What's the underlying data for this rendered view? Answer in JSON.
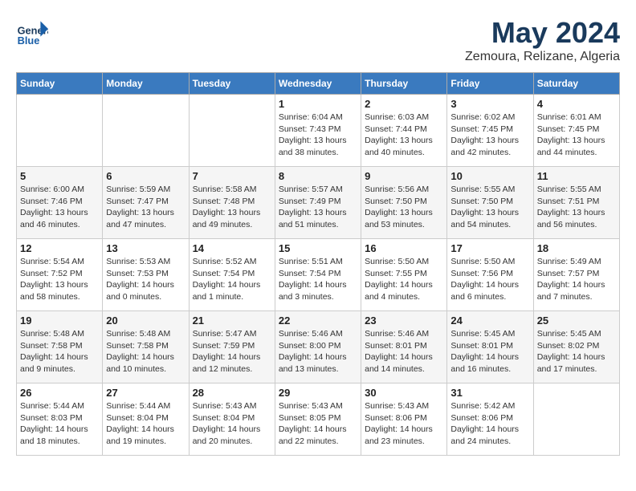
{
  "header": {
    "logo_line1": "General",
    "logo_line2": "Blue",
    "month": "May 2024",
    "location": "Zemoura, Relizane, Algeria"
  },
  "days_of_week": [
    "Sunday",
    "Monday",
    "Tuesday",
    "Wednesday",
    "Thursday",
    "Friday",
    "Saturday"
  ],
  "weeks": [
    [
      {
        "day": "",
        "info": ""
      },
      {
        "day": "",
        "info": ""
      },
      {
        "day": "",
        "info": ""
      },
      {
        "day": "1",
        "info": "Sunrise: 6:04 AM\nSunset: 7:43 PM\nDaylight: 13 hours\nand 38 minutes."
      },
      {
        "day": "2",
        "info": "Sunrise: 6:03 AM\nSunset: 7:44 PM\nDaylight: 13 hours\nand 40 minutes."
      },
      {
        "day": "3",
        "info": "Sunrise: 6:02 AM\nSunset: 7:45 PM\nDaylight: 13 hours\nand 42 minutes."
      },
      {
        "day": "4",
        "info": "Sunrise: 6:01 AM\nSunset: 7:45 PM\nDaylight: 13 hours\nand 44 minutes."
      }
    ],
    [
      {
        "day": "5",
        "info": "Sunrise: 6:00 AM\nSunset: 7:46 PM\nDaylight: 13 hours\nand 46 minutes."
      },
      {
        "day": "6",
        "info": "Sunrise: 5:59 AM\nSunset: 7:47 PM\nDaylight: 13 hours\nand 47 minutes."
      },
      {
        "day": "7",
        "info": "Sunrise: 5:58 AM\nSunset: 7:48 PM\nDaylight: 13 hours\nand 49 minutes."
      },
      {
        "day": "8",
        "info": "Sunrise: 5:57 AM\nSunset: 7:49 PM\nDaylight: 13 hours\nand 51 minutes."
      },
      {
        "day": "9",
        "info": "Sunrise: 5:56 AM\nSunset: 7:50 PM\nDaylight: 13 hours\nand 53 minutes."
      },
      {
        "day": "10",
        "info": "Sunrise: 5:55 AM\nSunset: 7:50 PM\nDaylight: 13 hours\nand 54 minutes."
      },
      {
        "day": "11",
        "info": "Sunrise: 5:55 AM\nSunset: 7:51 PM\nDaylight: 13 hours\nand 56 minutes."
      }
    ],
    [
      {
        "day": "12",
        "info": "Sunrise: 5:54 AM\nSunset: 7:52 PM\nDaylight: 13 hours\nand 58 minutes."
      },
      {
        "day": "13",
        "info": "Sunrise: 5:53 AM\nSunset: 7:53 PM\nDaylight: 14 hours\nand 0 minutes."
      },
      {
        "day": "14",
        "info": "Sunrise: 5:52 AM\nSunset: 7:54 PM\nDaylight: 14 hours\nand 1 minute."
      },
      {
        "day": "15",
        "info": "Sunrise: 5:51 AM\nSunset: 7:54 PM\nDaylight: 14 hours\nand 3 minutes."
      },
      {
        "day": "16",
        "info": "Sunrise: 5:50 AM\nSunset: 7:55 PM\nDaylight: 14 hours\nand 4 minutes."
      },
      {
        "day": "17",
        "info": "Sunrise: 5:50 AM\nSunset: 7:56 PM\nDaylight: 14 hours\nand 6 minutes."
      },
      {
        "day": "18",
        "info": "Sunrise: 5:49 AM\nSunset: 7:57 PM\nDaylight: 14 hours\nand 7 minutes."
      }
    ],
    [
      {
        "day": "19",
        "info": "Sunrise: 5:48 AM\nSunset: 7:58 PM\nDaylight: 14 hours\nand 9 minutes."
      },
      {
        "day": "20",
        "info": "Sunrise: 5:48 AM\nSunset: 7:58 PM\nDaylight: 14 hours\nand 10 minutes."
      },
      {
        "day": "21",
        "info": "Sunrise: 5:47 AM\nSunset: 7:59 PM\nDaylight: 14 hours\nand 12 minutes."
      },
      {
        "day": "22",
        "info": "Sunrise: 5:46 AM\nSunset: 8:00 PM\nDaylight: 14 hours\nand 13 minutes."
      },
      {
        "day": "23",
        "info": "Sunrise: 5:46 AM\nSunset: 8:01 PM\nDaylight: 14 hours\nand 14 minutes."
      },
      {
        "day": "24",
        "info": "Sunrise: 5:45 AM\nSunset: 8:01 PM\nDaylight: 14 hours\nand 16 minutes."
      },
      {
        "day": "25",
        "info": "Sunrise: 5:45 AM\nSunset: 8:02 PM\nDaylight: 14 hours\nand 17 minutes."
      }
    ],
    [
      {
        "day": "26",
        "info": "Sunrise: 5:44 AM\nSunset: 8:03 PM\nDaylight: 14 hours\nand 18 minutes."
      },
      {
        "day": "27",
        "info": "Sunrise: 5:44 AM\nSunset: 8:04 PM\nDaylight: 14 hours\nand 19 minutes."
      },
      {
        "day": "28",
        "info": "Sunrise: 5:43 AM\nSunset: 8:04 PM\nDaylight: 14 hours\nand 20 minutes."
      },
      {
        "day": "29",
        "info": "Sunrise: 5:43 AM\nSunset: 8:05 PM\nDaylight: 14 hours\nand 22 minutes."
      },
      {
        "day": "30",
        "info": "Sunrise: 5:43 AM\nSunset: 8:06 PM\nDaylight: 14 hours\nand 23 minutes."
      },
      {
        "day": "31",
        "info": "Sunrise: 5:42 AM\nSunset: 8:06 PM\nDaylight: 14 hours\nand 24 minutes."
      },
      {
        "day": "",
        "info": ""
      }
    ]
  ]
}
